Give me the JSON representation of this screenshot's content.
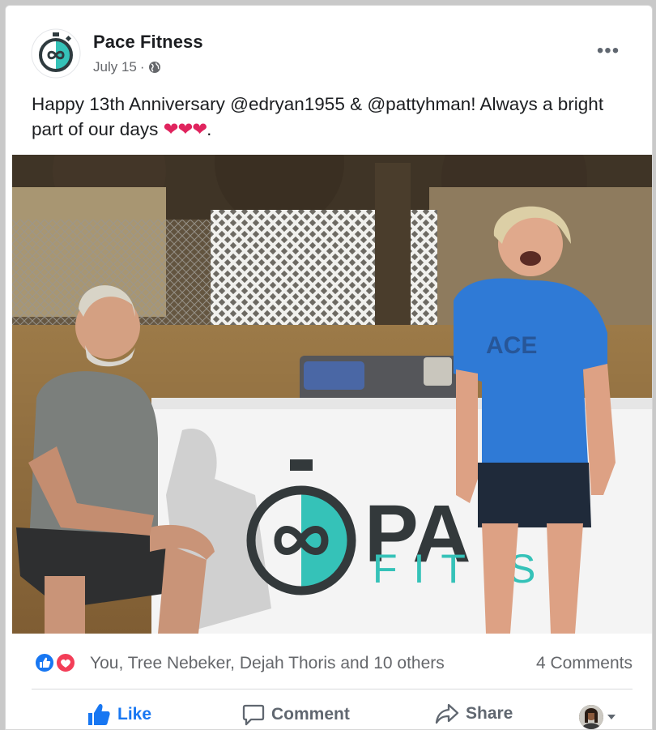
{
  "post": {
    "page_name": "Pace Fitness",
    "date": "July 15",
    "separator": "·",
    "more": "•••",
    "caption_text": "Happy 13th Anniversary @edryan1955 & @pattyhman! Always a bright part of our days ",
    "caption_emoji": "❤❤❤",
    "caption_end": ".",
    "photo": {
      "sign_brand": "PA",
      "sign_sub": "FIT    S"
    }
  },
  "reactions": {
    "names": "You, Tree Nebeker, Dejah Thoris and 10 others",
    "comments": "4 Comments"
  },
  "actions": {
    "like": "Like",
    "comment": "Comment",
    "share": "Share"
  },
  "colors": {
    "brand_teal": "#35c2b8",
    "like_blue": "#1877f2",
    "love_red": "#f33e58"
  }
}
